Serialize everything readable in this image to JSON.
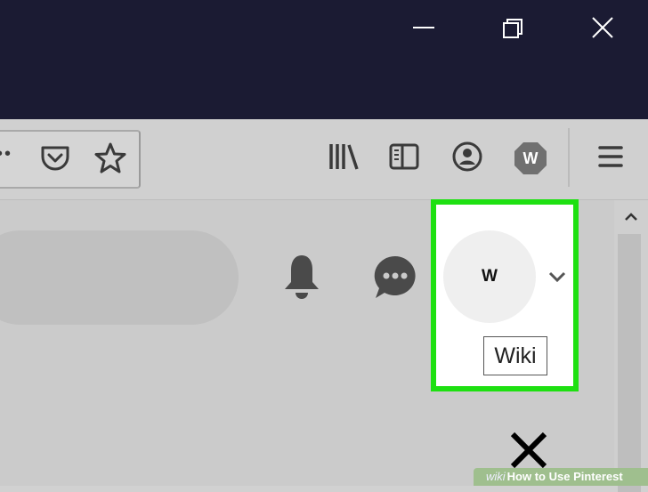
{
  "window": {
    "minimize_icon": "minimize-icon",
    "restore_icon": "restore-icon",
    "close_icon": "close-icon"
  },
  "toolbar": {
    "overflow_dots": "••",
    "icons": [
      "pocket-icon",
      "bookmark-star-icon",
      "library-icon",
      "sidebar-icon",
      "account-icon",
      "extension-w-icon",
      "hamburger-menu-icon"
    ],
    "extension_letter": "W"
  },
  "page": {
    "icons": [
      "notification-bell-icon",
      "messages-icon",
      "chevron-down-icon"
    ],
    "avatar_letter": "W",
    "tooltip": "Wiki"
  },
  "watermark": {
    "wiki": "wiki",
    "text": "How to Use Pinterest"
  },
  "colors": {
    "titlebar": "#1b1b33",
    "highlight": "#1ee011",
    "icon": "#3a3a3a"
  }
}
